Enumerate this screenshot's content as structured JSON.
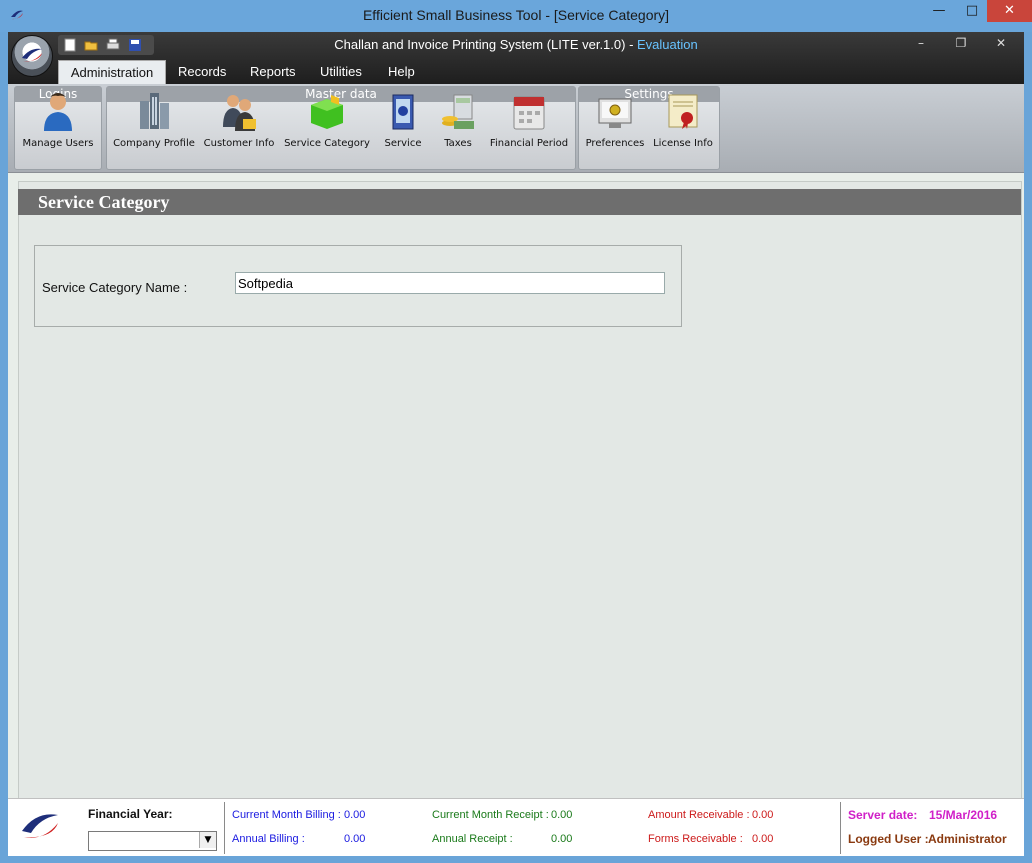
{
  "window": {
    "title": "Efficient Small Business Tool - [Service Category]",
    "controls": [
      "minimize",
      "maximize",
      "close"
    ]
  },
  "app": {
    "title_main": "Challan and Invoice Printing System (LITE ver.1.0) - ",
    "title_edition": "Evaluation",
    "quick_access_icons": [
      "new-icon",
      "open-folder-icon",
      "print-icon",
      "save-icon"
    ]
  },
  "menu": {
    "items": [
      {
        "label": "Administration",
        "active": true
      },
      {
        "label": "Records"
      },
      {
        "label": "Reports"
      },
      {
        "label": "Utilities"
      },
      {
        "label": "Help"
      }
    ]
  },
  "ribbon": {
    "groups": [
      {
        "label": "Logins",
        "buttons": [
          {
            "label": "Manage Users",
            "icon": "user-icon"
          }
        ]
      },
      {
        "label": "Master data",
        "buttons": [
          {
            "label": "Company Profile",
            "icon": "buildings-icon"
          },
          {
            "label": "Customer Info",
            "icon": "customers-icon"
          },
          {
            "label": "Service Category",
            "icon": "category-icon"
          },
          {
            "label": "Service",
            "icon": "service-icon"
          },
          {
            "label": "Taxes",
            "icon": "taxes-icon"
          },
          {
            "label": "Financial Period",
            "icon": "calendar-icon"
          }
        ]
      },
      {
        "label": "Settings",
        "buttons": [
          {
            "label": "Preferences",
            "icon": "preferences-icon"
          },
          {
            "label": "License Info",
            "icon": "certificate-icon"
          }
        ]
      }
    ]
  },
  "panel": {
    "title": "Service Category",
    "field_label": "Service Category Name :",
    "field_value": "Softpedia"
  },
  "status": {
    "financial_year_label": "Financial Year:",
    "financial_year_value": "",
    "current_month_billing_label": "Current Month Billing :",
    "current_month_billing_value": "0.00",
    "annual_billing_label": "Annual Billing :",
    "annual_billing_value": "0.00",
    "current_month_receipt_label": "Current Month Receipt :",
    "current_month_receipt_value": "0.00",
    "annual_receipt_label": "Annual Receipt :",
    "annual_receipt_value": "0.00",
    "amount_receivable_label": "Amount Receivable :",
    "amount_receivable_value": "0.00",
    "forms_receivable_label": "Forms Receivable :",
    "forms_receivable_value": "0.00",
    "server_date_label": "Server date:",
    "server_date_value": "15/Mar/2016",
    "logged_user_label": "Logged User :",
    "logged_user_value": "Administrator"
  },
  "colors": {
    "accent_blue": "#6aa6db",
    "evaluation": "#68c3ff",
    "panel_header": "#6e6e6e"
  }
}
